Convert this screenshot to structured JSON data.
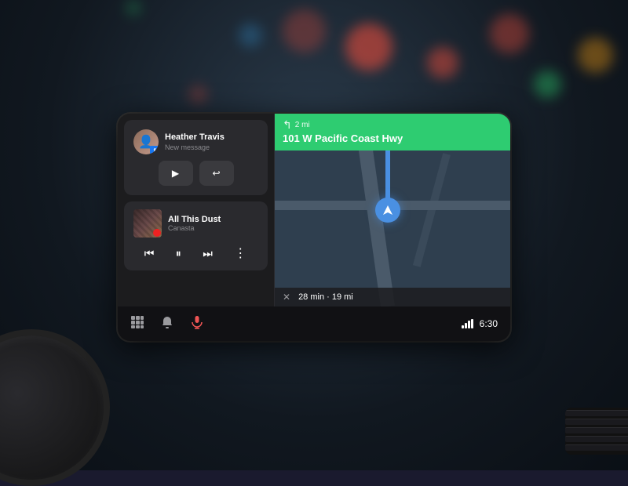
{
  "dashboard": {
    "background_color": "#1a1f28"
  },
  "screen": {
    "message_card": {
      "sender": "Heather Travis",
      "subtitle": "New message",
      "play_label": "▶",
      "reply_label": "↩"
    },
    "music_card": {
      "song_title": "All This Dust",
      "artist": "Canasta",
      "controls": {
        "prev": "⏮",
        "pause": "⏸",
        "next": "⏭",
        "more": "⋮"
      }
    },
    "navigation": {
      "distance": "2 mi",
      "turn_symbol": "↰",
      "street": "101 W Pacific Coast Hwy",
      "eta": "28 min · 19 mi"
    },
    "bottom_bar": {
      "grid_icon": "⊞",
      "bell_icon": "🔔",
      "mic_icon": "🎤",
      "time": "6:30"
    }
  }
}
